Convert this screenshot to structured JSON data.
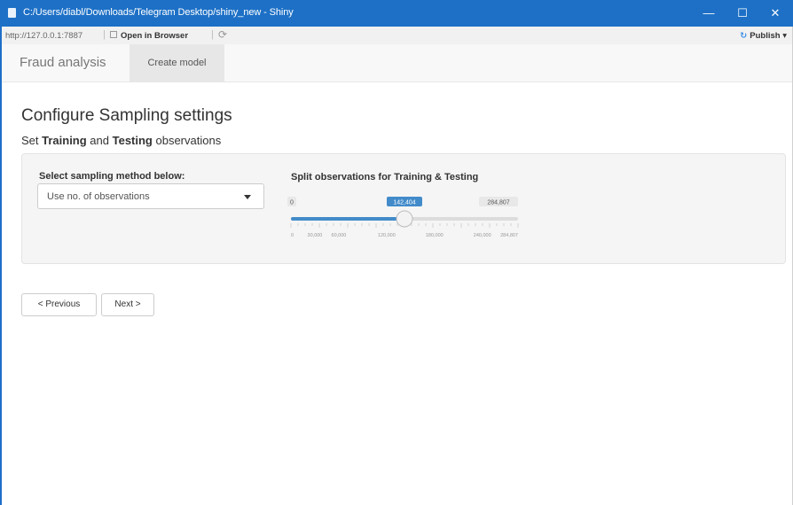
{
  "window": {
    "title": "C:/Users/diabl/Downloads/Telegram Desktop/shiny_new - Shiny",
    "minimize_icon": "—",
    "maximize_icon": "☐",
    "close_icon": "✕"
  },
  "addressbar": {
    "url": "http://127.0.0.1:7887",
    "open_in_browser": "Open in Browser",
    "publish": "Publish",
    "publish_icon": "↻",
    "publish_caret": "▾",
    "refresh_icon": "⟳"
  },
  "navbar": {
    "brand": "Fraud analysis",
    "tabs": [
      {
        "label": "Create model",
        "active": true
      }
    ]
  },
  "main": {
    "title": "Configure Sampling settings",
    "subtitle_parts": [
      "Set ",
      "Training",
      " and ",
      "Testing",
      " observations"
    ]
  },
  "sampling": {
    "method_label": "Select sampling method below:",
    "method_value": "Use no. of observations",
    "slider_label": "Split observations for Training & Testing",
    "slider": {
      "min": 0,
      "max": 284807,
      "value": 142404,
      "min_label": "0",
      "max_label": "284,807",
      "value_label": "142,404",
      "ticks": [
        {
          "value": 0,
          "label": "0"
        },
        {
          "value": 30000,
          "label": "30,000"
        },
        {
          "value": 60000,
          "label": "60,000"
        },
        {
          "value": 120000,
          "label": "120,000"
        },
        {
          "value": 180000,
          "label": "180,000"
        },
        {
          "value": 240000,
          "label": "240,000"
        },
        {
          "value": 284807,
          "label": "284,807"
        }
      ]
    },
    "accent_color": "#428bca"
  },
  "buttons": {
    "previous": "< Previous",
    "next": "Next >"
  }
}
